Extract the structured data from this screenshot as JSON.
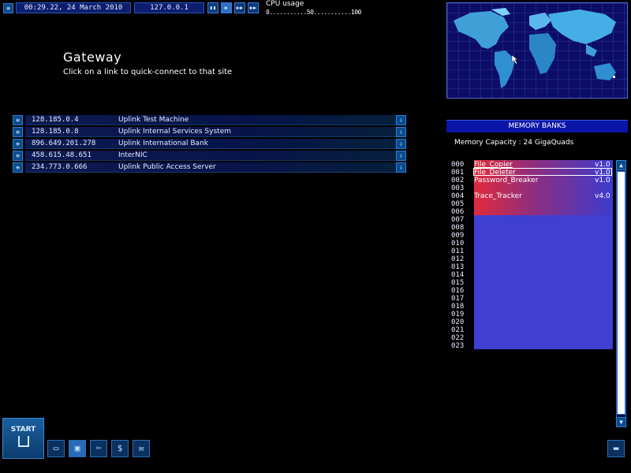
{
  "topbar": {
    "datetime": "00:29.22, 24 March 2010",
    "ip": "127.0.0.1",
    "speed_controls": [
      "pause-icon",
      "play-icon",
      "fast-forward-icon",
      "fastest-forward-icon"
    ],
    "cpu_label": "CPU usage",
    "cpu_scale": "0...........50...........100"
  },
  "gateway": {
    "title": "Gateway",
    "subtitle": "Click on a link to quick-connect to that site",
    "links": [
      {
        "ip": "128.185.0.4",
        "name": "Uplink Test Machine"
      },
      {
        "ip": "128.185.0.8",
        "name": "Uplink Internal Services System"
      },
      {
        "ip": "896.649.201.278",
        "name": "Uplink International Bank"
      },
      {
        "ip": "458.615.48.651",
        "name": "InterNIC"
      },
      {
        "ip": "234.773.0.666",
        "name": "Uplink Public Access Server"
      }
    ]
  },
  "memory": {
    "header": "MEMORY BANKS",
    "capacity": "Memory Capacity : 24 GigaQuads",
    "slots": [
      "000",
      "001",
      "002",
      "003",
      "004",
      "005",
      "006",
      "007",
      "008",
      "009",
      "010",
      "011",
      "012",
      "013",
      "014",
      "015",
      "016",
      "017",
      "018",
      "019",
      "020",
      "021",
      "022",
      "023"
    ],
    "files": [
      {
        "name": "File_Copier",
        "version": "v1.0"
      },
      {
        "name": "File_Deleter",
        "version": "v1.0"
      },
      {
        "name": "Password_Breaker",
        "version": "v1.0"
      },
      {
        "name": "Trace_Tracker",
        "version": "v4.0"
      }
    ]
  },
  "taskbar": {
    "start_label": "START",
    "icons": [
      "computer-icon",
      "floppy-disk-icon",
      "tools-icon",
      "dollar-icon",
      "email-icon"
    ]
  },
  "colors": {
    "accent": "#1a3aa8",
    "memory_red": "#e02b3a",
    "memory_blue": "#3c3ccf"
  }
}
